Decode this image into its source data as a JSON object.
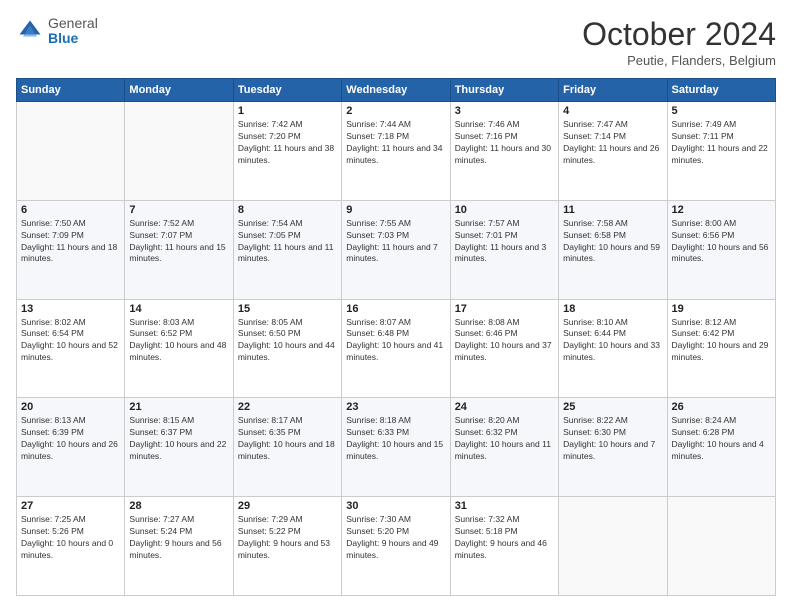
{
  "logo": {
    "general": "General",
    "blue": "Blue"
  },
  "header": {
    "month": "October 2024",
    "location": "Peutie, Flanders, Belgium"
  },
  "weekdays": [
    "Sunday",
    "Monday",
    "Tuesday",
    "Wednesday",
    "Thursday",
    "Friday",
    "Saturday"
  ],
  "weeks": [
    [
      {
        "day": "",
        "sunrise": "",
        "sunset": "",
        "daylight": ""
      },
      {
        "day": "",
        "sunrise": "",
        "sunset": "",
        "daylight": ""
      },
      {
        "day": "1",
        "sunrise": "Sunrise: 7:42 AM",
        "sunset": "Sunset: 7:20 PM",
        "daylight": "Daylight: 11 hours and 38 minutes."
      },
      {
        "day": "2",
        "sunrise": "Sunrise: 7:44 AM",
        "sunset": "Sunset: 7:18 PM",
        "daylight": "Daylight: 11 hours and 34 minutes."
      },
      {
        "day": "3",
        "sunrise": "Sunrise: 7:46 AM",
        "sunset": "Sunset: 7:16 PM",
        "daylight": "Daylight: 11 hours and 30 minutes."
      },
      {
        "day": "4",
        "sunrise": "Sunrise: 7:47 AM",
        "sunset": "Sunset: 7:14 PM",
        "daylight": "Daylight: 11 hours and 26 minutes."
      },
      {
        "day": "5",
        "sunrise": "Sunrise: 7:49 AM",
        "sunset": "Sunset: 7:11 PM",
        "daylight": "Daylight: 11 hours and 22 minutes."
      }
    ],
    [
      {
        "day": "6",
        "sunrise": "Sunrise: 7:50 AM",
        "sunset": "Sunset: 7:09 PM",
        "daylight": "Daylight: 11 hours and 18 minutes."
      },
      {
        "day": "7",
        "sunrise": "Sunrise: 7:52 AM",
        "sunset": "Sunset: 7:07 PM",
        "daylight": "Daylight: 11 hours and 15 minutes."
      },
      {
        "day": "8",
        "sunrise": "Sunrise: 7:54 AM",
        "sunset": "Sunset: 7:05 PM",
        "daylight": "Daylight: 11 hours and 11 minutes."
      },
      {
        "day": "9",
        "sunrise": "Sunrise: 7:55 AM",
        "sunset": "Sunset: 7:03 PM",
        "daylight": "Daylight: 11 hours and 7 minutes."
      },
      {
        "day": "10",
        "sunrise": "Sunrise: 7:57 AM",
        "sunset": "Sunset: 7:01 PM",
        "daylight": "Daylight: 11 hours and 3 minutes."
      },
      {
        "day": "11",
        "sunrise": "Sunrise: 7:58 AM",
        "sunset": "Sunset: 6:58 PM",
        "daylight": "Daylight: 10 hours and 59 minutes."
      },
      {
        "day": "12",
        "sunrise": "Sunrise: 8:00 AM",
        "sunset": "Sunset: 6:56 PM",
        "daylight": "Daylight: 10 hours and 56 minutes."
      }
    ],
    [
      {
        "day": "13",
        "sunrise": "Sunrise: 8:02 AM",
        "sunset": "Sunset: 6:54 PM",
        "daylight": "Daylight: 10 hours and 52 minutes."
      },
      {
        "day": "14",
        "sunrise": "Sunrise: 8:03 AM",
        "sunset": "Sunset: 6:52 PM",
        "daylight": "Daylight: 10 hours and 48 minutes."
      },
      {
        "day": "15",
        "sunrise": "Sunrise: 8:05 AM",
        "sunset": "Sunset: 6:50 PM",
        "daylight": "Daylight: 10 hours and 44 minutes."
      },
      {
        "day": "16",
        "sunrise": "Sunrise: 8:07 AM",
        "sunset": "Sunset: 6:48 PM",
        "daylight": "Daylight: 10 hours and 41 minutes."
      },
      {
        "day": "17",
        "sunrise": "Sunrise: 8:08 AM",
        "sunset": "Sunset: 6:46 PM",
        "daylight": "Daylight: 10 hours and 37 minutes."
      },
      {
        "day": "18",
        "sunrise": "Sunrise: 8:10 AM",
        "sunset": "Sunset: 6:44 PM",
        "daylight": "Daylight: 10 hours and 33 minutes."
      },
      {
        "day": "19",
        "sunrise": "Sunrise: 8:12 AM",
        "sunset": "Sunset: 6:42 PM",
        "daylight": "Daylight: 10 hours and 29 minutes."
      }
    ],
    [
      {
        "day": "20",
        "sunrise": "Sunrise: 8:13 AM",
        "sunset": "Sunset: 6:39 PM",
        "daylight": "Daylight: 10 hours and 26 minutes."
      },
      {
        "day": "21",
        "sunrise": "Sunrise: 8:15 AM",
        "sunset": "Sunset: 6:37 PM",
        "daylight": "Daylight: 10 hours and 22 minutes."
      },
      {
        "day": "22",
        "sunrise": "Sunrise: 8:17 AM",
        "sunset": "Sunset: 6:35 PM",
        "daylight": "Daylight: 10 hours and 18 minutes."
      },
      {
        "day": "23",
        "sunrise": "Sunrise: 8:18 AM",
        "sunset": "Sunset: 6:33 PM",
        "daylight": "Daylight: 10 hours and 15 minutes."
      },
      {
        "day": "24",
        "sunrise": "Sunrise: 8:20 AM",
        "sunset": "Sunset: 6:32 PM",
        "daylight": "Daylight: 10 hours and 11 minutes."
      },
      {
        "day": "25",
        "sunrise": "Sunrise: 8:22 AM",
        "sunset": "Sunset: 6:30 PM",
        "daylight": "Daylight: 10 hours and 7 minutes."
      },
      {
        "day": "26",
        "sunrise": "Sunrise: 8:24 AM",
        "sunset": "Sunset: 6:28 PM",
        "daylight": "Daylight: 10 hours and 4 minutes."
      }
    ],
    [
      {
        "day": "27",
        "sunrise": "Sunrise: 7:25 AM",
        "sunset": "Sunset: 5:26 PM",
        "daylight": "Daylight: 10 hours and 0 minutes."
      },
      {
        "day": "28",
        "sunrise": "Sunrise: 7:27 AM",
        "sunset": "Sunset: 5:24 PM",
        "daylight": "Daylight: 9 hours and 56 minutes."
      },
      {
        "day": "29",
        "sunrise": "Sunrise: 7:29 AM",
        "sunset": "Sunset: 5:22 PM",
        "daylight": "Daylight: 9 hours and 53 minutes."
      },
      {
        "day": "30",
        "sunrise": "Sunrise: 7:30 AM",
        "sunset": "Sunset: 5:20 PM",
        "daylight": "Daylight: 9 hours and 49 minutes."
      },
      {
        "day": "31",
        "sunrise": "Sunrise: 7:32 AM",
        "sunset": "Sunset: 5:18 PM",
        "daylight": "Daylight: 9 hours and 46 minutes."
      },
      {
        "day": "",
        "sunrise": "",
        "sunset": "",
        "daylight": ""
      },
      {
        "day": "",
        "sunrise": "",
        "sunset": "",
        "daylight": ""
      }
    ]
  ]
}
